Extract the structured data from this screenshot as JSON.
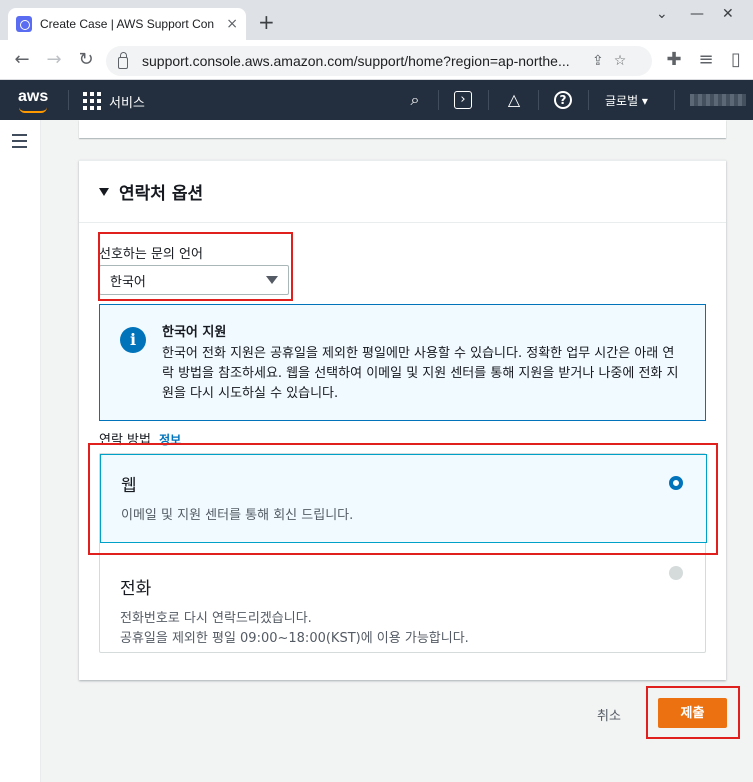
{
  "browser": {
    "tab_title": "Create Case | AWS Support Con",
    "tab_close": "×",
    "new_tab": "+",
    "url": "support.console.aws.amazon.com/support/home?region=ap-northe...",
    "controls": {
      "minimize": "—",
      "maximize": "☐",
      "close": "✕",
      "chevron": "⌄"
    }
  },
  "aws_header": {
    "logo": "aws",
    "services_label": "서비스",
    "region_label": "글로벌 ▾"
  },
  "contact_options": {
    "title": "연락처 옵션",
    "language": {
      "label": "선호하는 문의 언어",
      "selected": "한국어"
    },
    "info_alert": {
      "title": "한국어 지원",
      "body": "한국어 전화 지원은 공휴일을 제외한 평일에만 사용할 수 있습니다. 정확한 업무 시간은 아래 연락 방법을 참조하세요. 웹을 선택하여 이메일 및 지원 센터를 통해 지원을 받거나 나중에 전화 지원을 다시 시도하실 수 있습니다."
    },
    "contact_method": {
      "label": "연락 방법",
      "info_link": "정보",
      "options": [
        {
          "title": "웹",
          "desc": "이메일 및 지원 센터를 통해 회신 드립니다.",
          "selected": true
        },
        {
          "title": "전화",
          "desc_line1": "전화번호로 다시 연락드리겠습니다.",
          "desc_line2": "공휴일을 제외한 평일 09:00~18:00(KST)에 이용 가능합니다.",
          "selected": false
        }
      ]
    }
  },
  "actions": {
    "cancel": "취소",
    "submit": "제출"
  },
  "colors": {
    "aws_nav": "#232f3e",
    "primary_button": "#ec7211",
    "link": "#0073bb",
    "annotation": "#e0201c"
  }
}
